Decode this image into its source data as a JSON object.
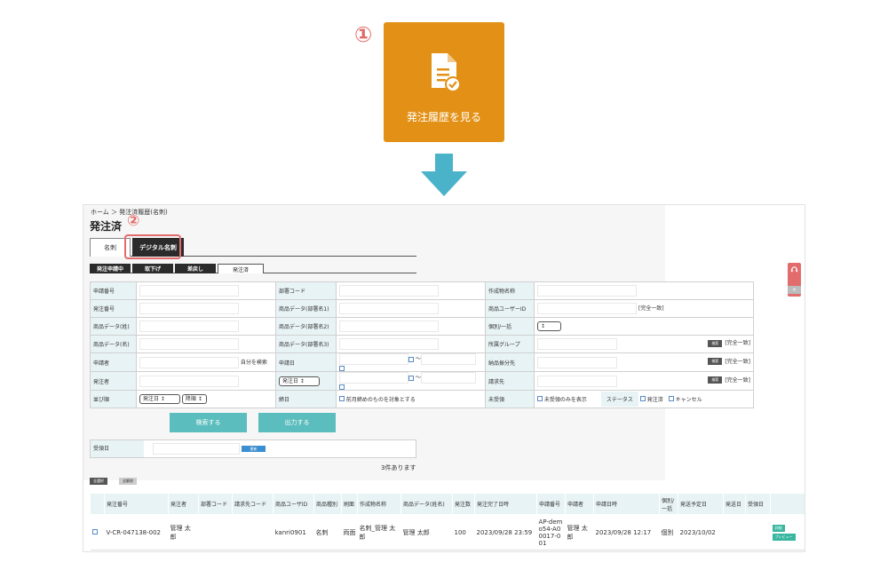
{
  "guide": {
    "step1": "①",
    "history_button_label": "発注履歴を見る",
    "step2": "②"
  },
  "page": {
    "breadcrumb": "ホーム ＞ 発注済履歴(名刺)",
    "title": "発注済",
    "main_tabs": [
      "名刺",
      "デジタル名刺"
    ],
    "sub_tabs": [
      "発注申請中",
      "取下げ",
      "差戻し",
      "発注済"
    ]
  },
  "form": {
    "row1": [
      "申請番号",
      "部署コード",
      "作成物名称"
    ],
    "row2": [
      "発注番号",
      "商品データ(部署名1)",
      "商品ユーザーID",
      "[完全一致]"
    ],
    "row3": [
      "商品データ(姓)",
      "商品データ(部署名2)",
      "個別/一括"
    ],
    "row4": [
      "商品データ(名)",
      "商品データ(部署名3)",
      "所属グループ",
      "検索",
      "[完全一致]"
    ],
    "row5": [
      "申請者",
      "自分を検索",
      "申請日",
      "〜",
      "納品振分先",
      "検索",
      "[完全一致]"
    ],
    "row6": [
      "発注者",
      "発注日",
      "〜",
      "請求先",
      "検索",
      "[完全一致]"
    ],
    "row7": [
      "並び順",
      "発注日",
      "降順",
      "締日",
      "前月締めのものを対象とする",
      "未受領",
      "未受領のみを表示",
      "ステータス",
      "発注済",
      "キャンセル"
    ]
  },
  "buttons": {
    "search": "検索する",
    "output": "出力する"
  },
  "receipt": {
    "label": "受領日",
    "button": "更新"
  },
  "results": {
    "count": "3件あります",
    "select_all": "全選択",
    "clear_all": "全解除",
    "headers": [
      "発注番号",
      "発注者",
      "部署コード",
      "請求先コード",
      "商品ユーザID",
      "商品種別",
      "刷面",
      "作成物名称",
      "商品データ(姓名)",
      "発注数",
      "発注完了日時",
      "申請番号",
      "申請者",
      "申請日時",
      "個別/一括",
      "発送予定日",
      "発送日",
      "受領日"
    ],
    "row": [
      "V-CR-047138-002",
      "管理 太郎",
      "",
      "",
      "kanri0901",
      "名刺",
      "両面",
      "名刺_管理 太郎",
      "管理 太郎",
      "100",
      "2023/09/28 23:59",
      "AP-demo54-A00017-001",
      "管理 太郎",
      "2023/09/28 12:17",
      "個別",
      "2023/10/02",
      "",
      ""
    ],
    "detail_button": "詳細",
    "preview_button": "プレビュー"
  },
  "colors": {
    "accent_orange": "#e39116",
    "teal": "#5bbdbd",
    "highlight_red": "#e26c6c",
    "arrow": "#4ab3c9"
  }
}
